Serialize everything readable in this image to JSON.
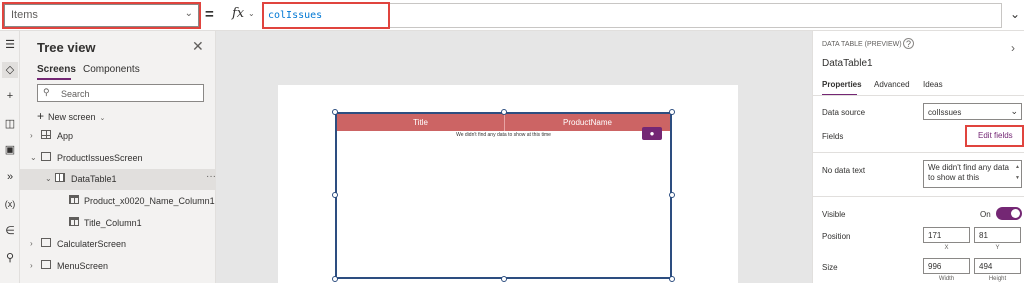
{
  "formula_bar": {
    "property": "Items",
    "equals": "=",
    "fx": "fx",
    "formula": "colIssues"
  },
  "rail": {
    "icons": [
      "hamburger-icon",
      "layers-icon",
      "plus-icon",
      "database-icon",
      "media-icon",
      "power-automate-icon",
      "variables-icon",
      "tools-icon",
      "search-icon"
    ],
    "variables_glyph": "(x)"
  },
  "tree_view": {
    "title": "Tree view",
    "tabs": [
      "Screens",
      "Components"
    ],
    "search_placeholder": "Search",
    "new_screen_label": "New screen",
    "items": [
      {
        "label": "App"
      },
      {
        "label": "ProductIssuesScreen"
      },
      {
        "label": "DataTable1"
      },
      {
        "label": "Product_x0020_Name_Column1"
      },
      {
        "label": "Title_Column1"
      },
      {
        "label": "CalculaterScreen"
      },
      {
        "label": "MenuScreen"
      }
    ],
    "more": "···"
  },
  "canvas": {
    "columns": [
      "Title",
      "ProductName"
    ],
    "empty_text": "We didn't find any data to show at this time"
  },
  "properties_panel": {
    "control_type": "DATA TABLE (PREVIEW)",
    "help": "?",
    "control_name": "DataTable1",
    "tabs": [
      "Properties",
      "Advanced",
      "Ideas"
    ],
    "data_source_label": "Data source",
    "data_source_value": "colIssues",
    "fields_label": "Fields",
    "edit_fields_label": "Edit fields",
    "no_data_label": "No data text",
    "no_data_value": "We didn't find any data to show at this",
    "visible_label": "Visible",
    "visible_state": "On",
    "position_label": "Position",
    "position_x": "171",
    "position_y": "81",
    "x_caption": "X",
    "y_caption": "Y",
    "size_label": "Size",
    "width": "996",
    "height": "494",
    "width_caption": "Width",
    "height_caption": "Height"
  },
  "colors": {
    "accent": "#742774",
    "header": "#cc6464",
    "highlight": "#e0443e",
    "selection": "#2d4e80"
  }
}
